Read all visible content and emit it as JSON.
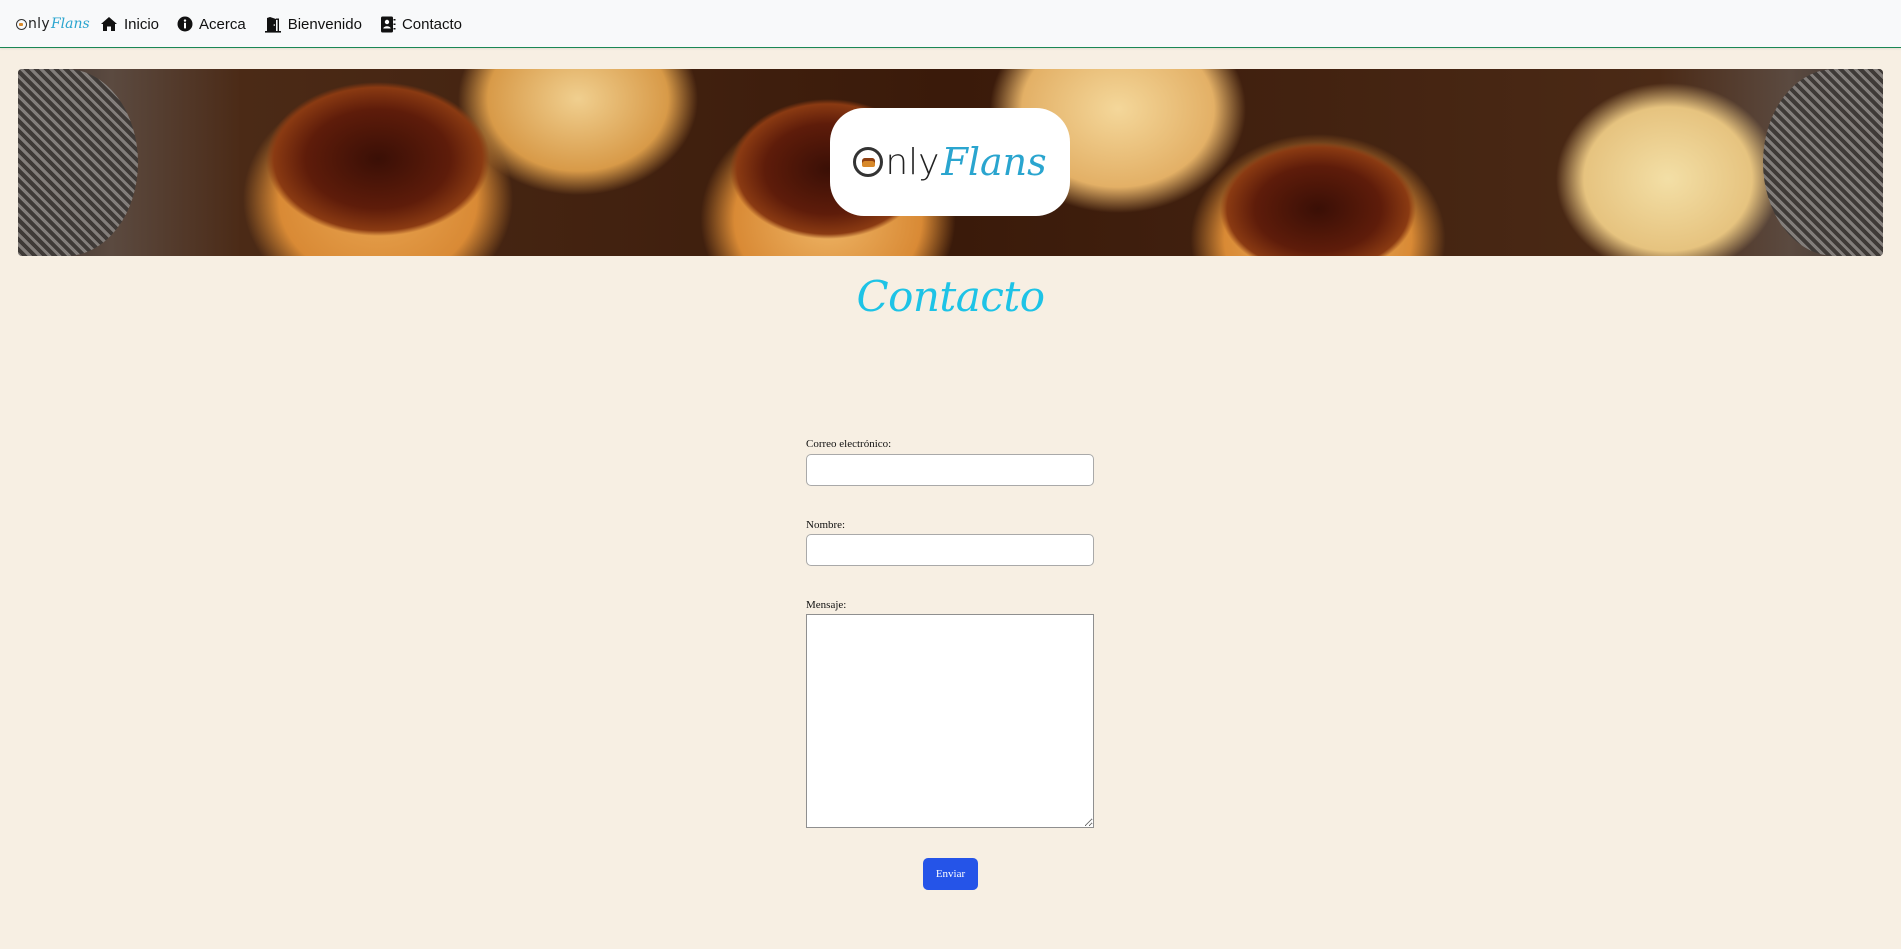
{
  "brand": {
    "only": "nly",
    "flans": "Flans"
  },
  "nav": {
    "items": [
      {
        "label": "Inicio",
        "icon": "house-icon"
      },
      {
        "label": "Acerca",
        "icon": "info-circle-icon"
      },
      {
        "label": "Bienvenido",
        "icon": "door-open-icon"
      },
      {
        "label": "Contacto",
        "icon": "contact-book-icon"
      }
    ]
  },
  "banner": {
    "logo_only": "nly",
    "logo_flans": "Flans"
  },
  "page": {
    "title": "Contacto"
  },
  "form": {
    "email_label": "Correo electrónico:",
    "email_value": "",
    "name_label": "Nombre:",
    "name_value": "",
    "message_label": "Mensaje:",
    "message_value": "",
    "submit_label": "Enviar"
  },
  "colors": {
    "background": "#f7efe3",
    "title": "#1ec3e6",
    "button": "#2554e8",
    "nav_border": "#198754",
    "brand_blue": "#2aa5cf"
  }
}
